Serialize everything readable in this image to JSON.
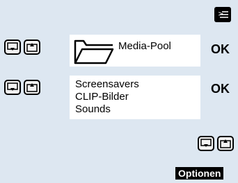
{
  "row1": {
    "label": "Media-Pool",
    "ok": "OK"
  },
  "row2": {
    "items": [
      "Screensavers",
      "CLIP-Bilder",
      "Sounds"
    ],
    "ok": "OK"
  },
  "softkey": {
    "label": "Optionen"
  },
  "icons": {
    "menu": "menu-icon",
    "folder": "folder-icon",
    "down": "arrow-down-key-icon",
    "up": "arrow-up-key-icon"
  }
}
